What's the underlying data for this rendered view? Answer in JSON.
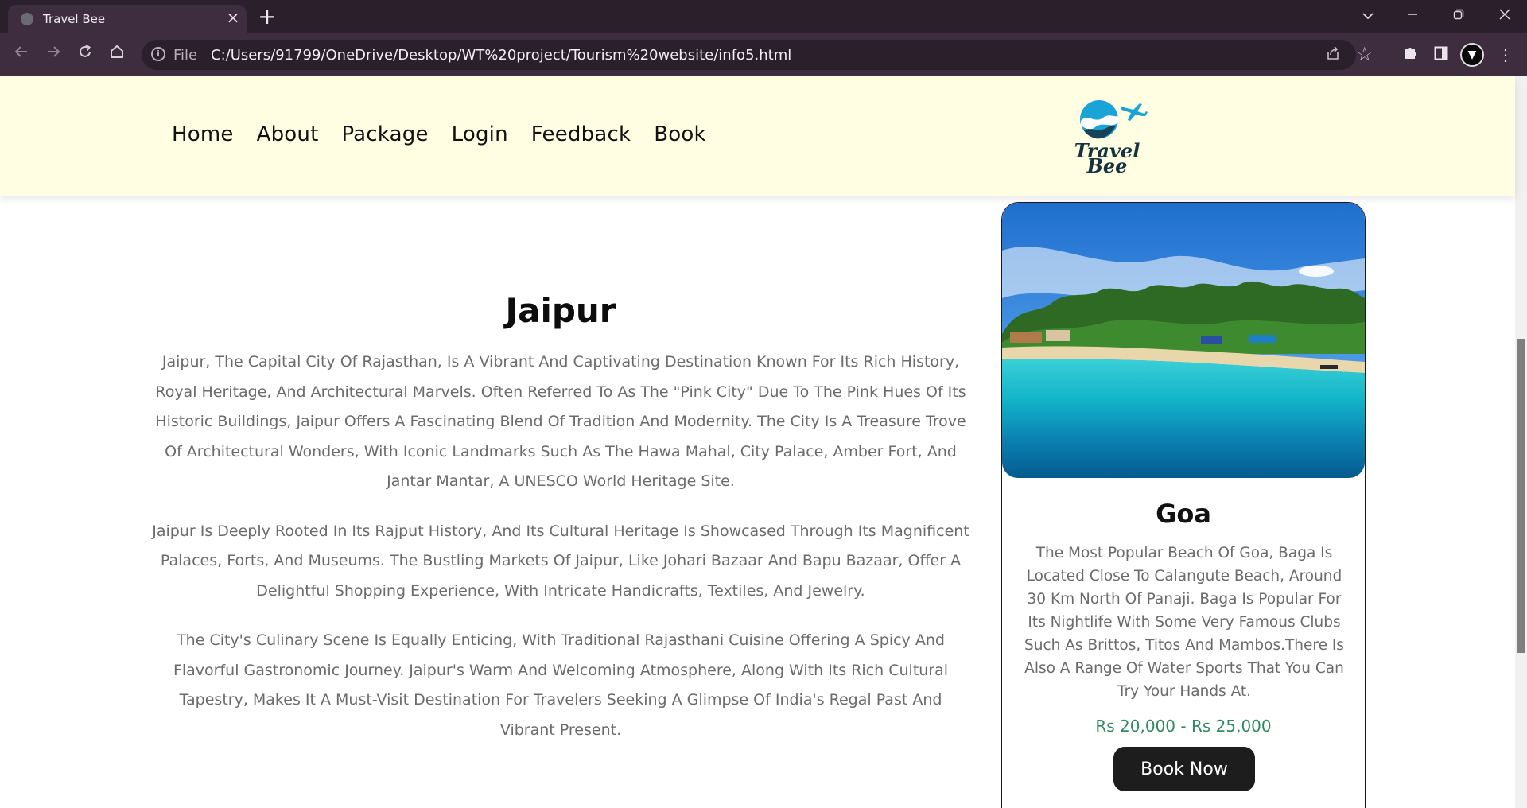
{
  "browser": {
    "tab_title": "Travel Bee",
    "tab_close": "×",
    "new_tab": "+",
    "url_scheme_label": "File",
    "url": "C:/Users/91799/OneDrive/Desktop/WT%20project/Tourism%20website/info5.html"
  },
  "nav": {
    "items": [
      "Home",
      "About",
      "Package",
      "Login",
      "Feedback",
      "Book"
    ]
  },
  "logo": {
    "line1": "Travel",
    "line2": "Bee",
    "primary_color": "#1aa3d6",
    "dark_color": "#16323f"
  },
  "article": {
    "title": "Jaipur",
    "paragraphs": [
      "Jaipur, The Capital City Of Rajasthan, Is A Vibrant And Captivating Destination Known For Its Rich History, Royal Heritage, And Architectural Marvels. Often Referred To As The \"Pink City\" Due To The Pink Hues Of Its Historic Buildings, Jaipur Offers A Fascinating Blend Of Tradition And Modernity. The City Is A Treasure Trove Of Architectural Wonders, With Iconic Landmarks Such As The Hawa Mahal, City Palace, Amber Fort, And Jantar Mantar, A UNESCO World Heritage Site.",
      "Jaipur Is Deeply Rooted In Its Rajput History, And Its Cultural Heritage Is Showcased Through Its Magnificent Palaces, Forts, And Museums. The Bustling Markets Of Jaipur, Like Johari Bazaar And Bapu Bazaar, Offer A Delightful Shopping Experience, With Intricate Handicrafts, Textiles, And Jewelry.",
      "The City's Culinary Scene Is Equally Enticing, With Traditional Rajasthani Cuisine Offering A Spicy And Flavorful Gastronomic Journey. Jaipur's Warm And Welcoming Atmosphere, Along With Its Rich Cultural Tapestry, Makes It A Must-Visit Destination For Travelers Seeking A Glimpse Of India's Regal Past And Vibrant Present."
    ]
  },
  "card": {
    "title": "Goa",
    "description": "The Most Popular Beach Of Goa, Baga Is Located Close To Calangute Beach, Around 30 Km North Of Panaji. Baga Is Popular For Its Nightlife With Some Very Famous Clubs Such As Brittos, Titos And Mambos.There Is Also A Range Of Water Sports That You Can Try Your Hands At.",
    "price": "Rs 20,000 - Rs 25,000",
    "button_label": "Book Now",
    "price_color": "#2f8a63"
  },
  "colors": {
    "header_bg": "#fffee2",
    "chrome_dark": "#2c1f2c",
    "chrome_mid": "#3e2d3e"
  }
}
